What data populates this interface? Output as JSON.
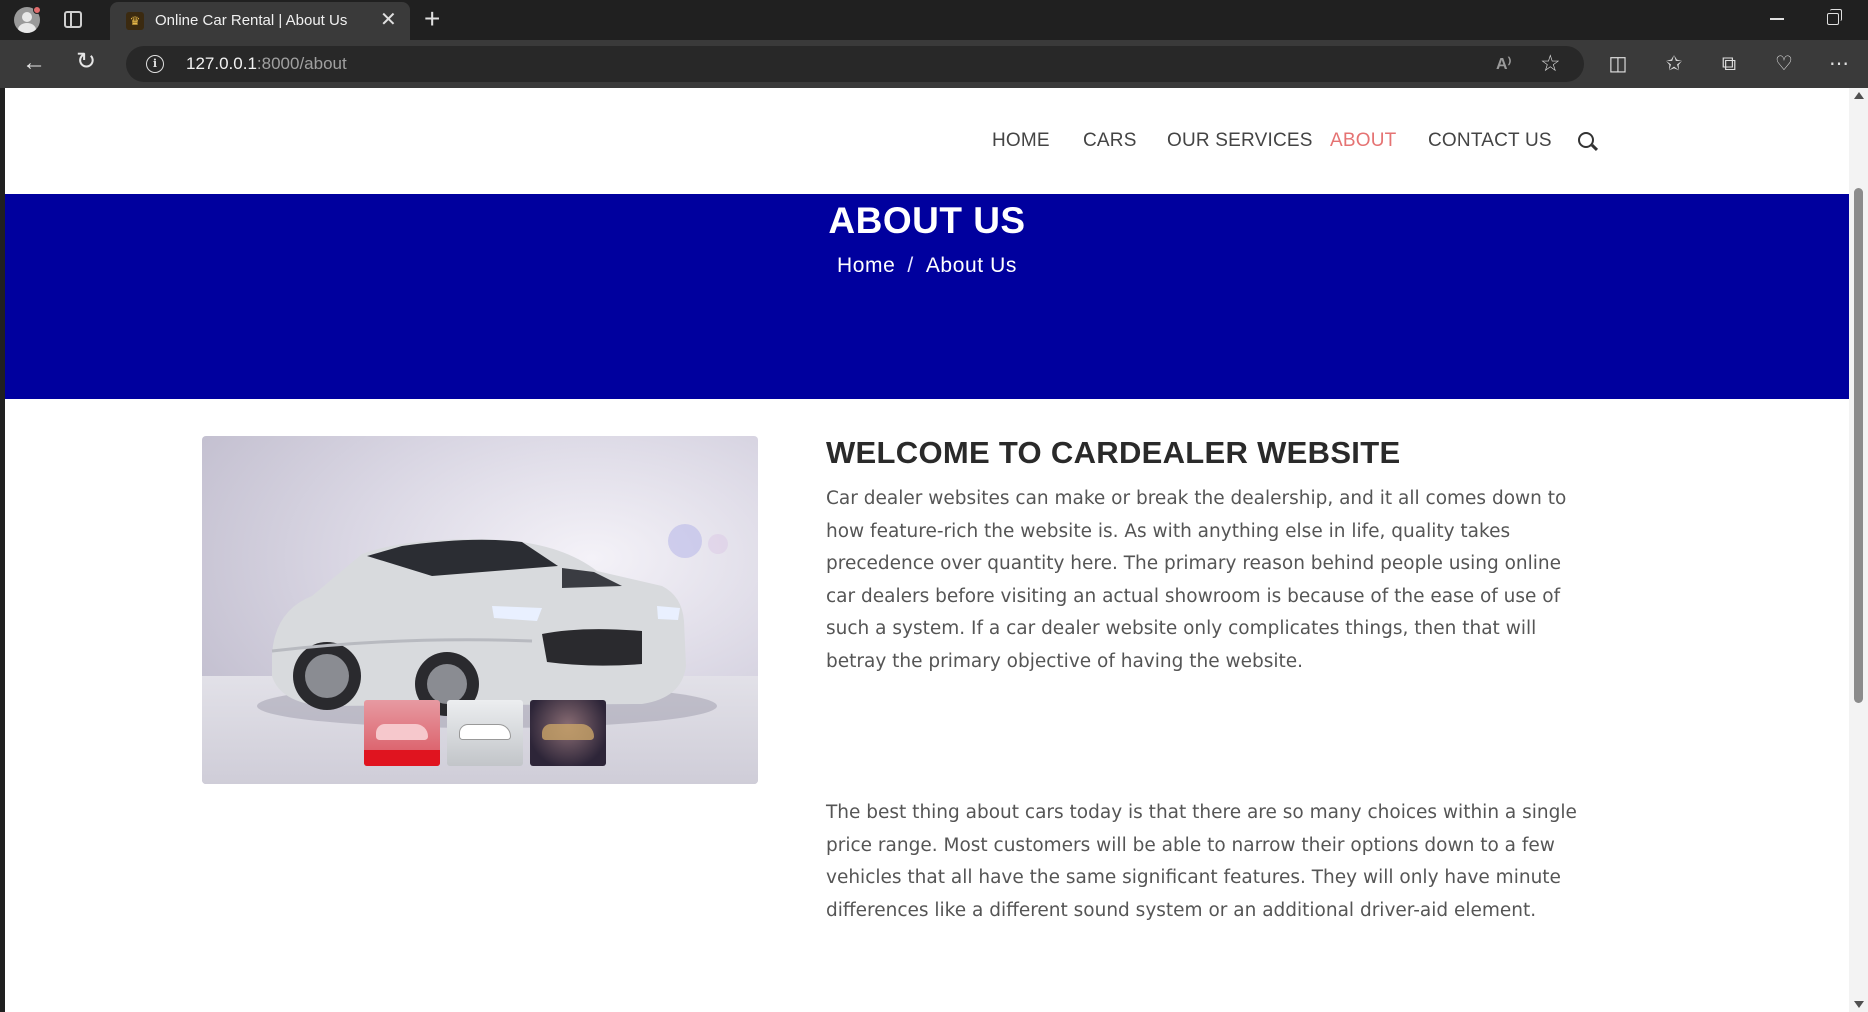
{
  "browser": {
    "tab_title": "Online Car Rental | About Us",
    "tab_favicon_icon": "crest-icon",
    "url_host": "127.0.0.1",
    "url_path": ":8000/about",
    "read_aloud_label": "A⁾"
  },
  "nav": {
    "items": [
      {
        "label": "HOME",
        "active": false
      },
      {
        "label": "CARS",
        "active": false
      },
      {
        "label": "OUR SERVICES",
        "active": false
      },
      {
        "label": "ABOUT",
        "active": true
      },
      {
        "label": "CONTACT US",
        "active": false
      }
    ],
    "search_icon": "search-icon",
    "active_color": "#e57373"
  },
  "banner": {
    "title": "ABOUT US",
    "breadcrumb": {
      "home": "Home",
      "separator": "/",
      "current": "About Us"
    },
    "background": "#00009e"
  },
  "about": {
    "heading": "WELCOME TO CARDEALER WEBSITE",
    "paragraph1": "Car dealer websites can make or break the dealership, and it all comes down to how feature-rich the website is. As with anything else in life, quality takes precedence over quantity here. The primary reason behind people using online car dealers before visiting an actual showroom is because of the ease of use of such a system. If a car dealer website only complicates things, then that will betray the primary objective of having the website.",
    "paragraph2": "The best thing about cars today is that there are so many choices within a single price range. Most customers will be able to narrow their options down to a few vehicles that all have the same significant features. They will only have minute differences like a different sound system or an additional driver-aid element."
  },
  "gallery": {
    "main_image": "silver-sedan-car-image",
    "thumbnails": [
      {
        "name": "red-car-thumbnail",
        "selected": true
      },
      {
        "name": "white-car-thumbnail",
        "selected": false
      },
      {
        "name": "dark-car-thumbnail",
        "selected": false
      }
    ]
  }
}
